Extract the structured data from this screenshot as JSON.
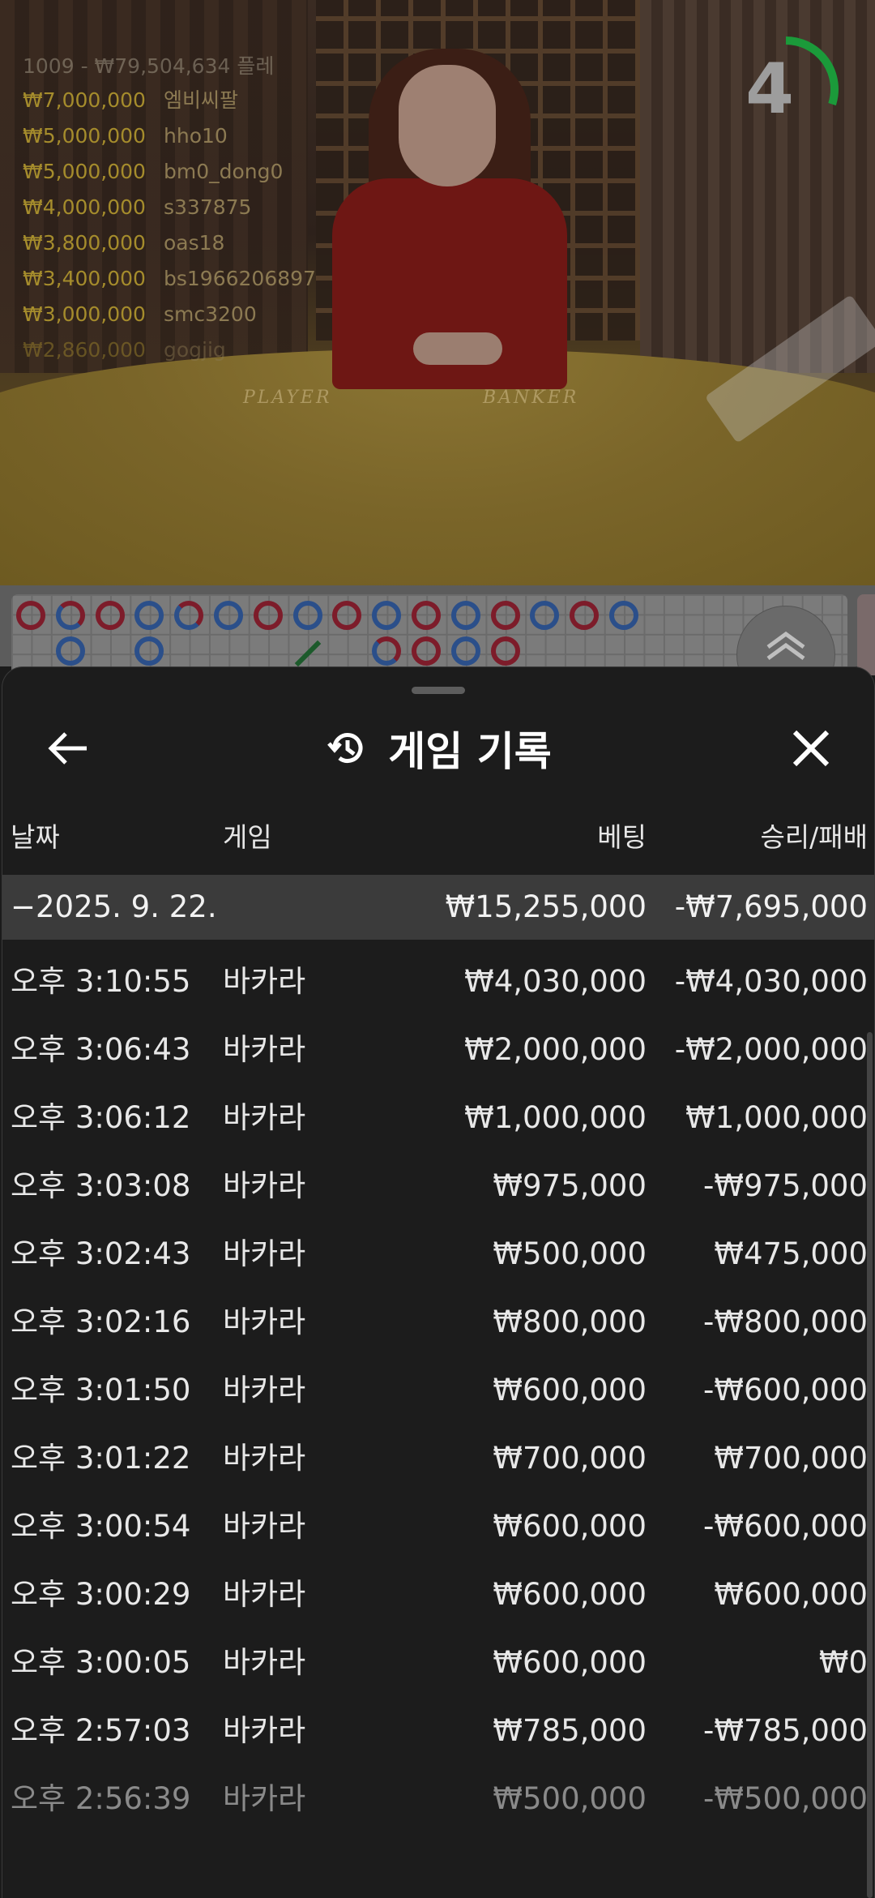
{
  "video": {
    "bet_feed_header": "1009 - ₩79,504,634 플레",
    "bets": [
      {
        "amount": "₩7,000,000",
        "user": "엠비씨팔"
      },
      {
        "amount": "₩5,000,000",
        "user": "hho10"
      },
      {
        "amount": "₩5,000,000",
        "user": "bm0_dong0"
      },
      {
        "amount": "₩4,000,000",
        "user": "s337875"
      },
      {
        "amount": "₩3,800,000",
        "user": "oas18"
      },
      {
        "amount": "₩3,400,000",
        "user": "bs1966206897"
      },
      {
        "amount": "₩3,000,000",
        "user": "smc3200"
      },
      {
        "amount": "₩2,860,000",
        "user": "gogjig"
      }
    ],
    "table_labels": {
      "player": "PLAYER",
      "banker": "BANKER"
    },
    "countdown": "4",
    "countdown_progress": 0.3,
    "accent_green": "#1b9a3a"
  },
  "roadmap": {
    "top_row": [
      "p",
      "split",
      "p",
      "b",
      "split",
      "b",
      "p",
      "b",
      "p",
      "b",
      "p",
      "b",
      "p",
      "b",
      "p",
      "b"
    ],
    "bottom_row": [
      {
        "col": 1,
        "type": "b"
      },
      {
        "col": 3,
        "type": "b"
      },
      {
        "col": 7,
        "type": "tie"
      },
      {
        "col": 9,
        "type": "split"
      },
      {
        "col": 10,
        "type": "p"
      },
      {
        "col": 11,
        "type": "b"
      },
      {
        "col": 12,
        "type": "p"
      }
    ],
    "scroll_icon": "chevron-up-double-icon"
  },
  "sheet": {
    "title": "게임 기록",
    "icons": {
      "back": "arrow-left-icon",
      "history": "history-icon",
      "close": "close-icon"
    },
    "columns": {
      "date": "날짜",
      "game": "게임",
      "bet": "베팅",
      "win_loss": "승리/패배"
    },
    "summary": {
      "date": "−2025. 9. 22.",
      "bet": "₩15,255,000",
      "win_loss": "-₩7,695,000"
    },
    "rows": [
      {
        "time": "오후 3:10:55",
        "game": "바카라",
        "bet": "₩4,030,000",
        "result": "-₩4,030,000"
      },
      {
        "time": "오후 3:06:43",
        "game": "바카라",
        "bet": "₩2,000,000",
        "result": "-₩2,000,000"
      },
      {
        "time": "오후 3:06:12",
        "game": "바카라",
        "bet": "₩1,000,000",
        "result": "₩1,000,000"
      },
      {
        "time": "오후 3:03:08",
        "game": "바카라",
        "bet": "₩975,000",
        "result": "-₩975,000"
      },
      {
        "time": "오후 3:02:43",
        "game": "바카라",
        "bet": "₩500,000",
        "result": "₩475,000"
      },
      {
        "time": "오후 3:02:16",
        "game": "바카라",
        "bet": "₩800,000",
        "result": "-₩800,000"
      },
      {
        "time": "오후 3:01:50",
        "game": "바카라",
        "bet": "₩600,000",
        "result": "-₩600,000"
      },
      {
        "time": "오후 3:01:22",
        "game": "바카라",
        "bet": "₩700,000",
        "result": "₩700,000"
      },
      {
        "time": "오후 3:00:54",
        "game": "바카라",
        "bet": "₩600,000",
        "result": "-₩600,000"
      },
      {
        "time": "오후 3:00:29",
        "game": "바카라",
        "bet": "₩600,000",
        "result": "₩600,000"
      },
      {
        "time": "오후 3:00:05",
        "game": "바카라",
        "bet": "₩600,000",
        "result": "₩0"
      },
      {
        "time": "오후 2:57:03",
        "game": "바카라",
        "bet": "₩785,000",
        "result": "-₩785,000"
      },
      {
        "time": "오후 2:56:39",
        "game": "바카라",
        "bet": "₩500,000",
        "result": "-₩500,000"
      }
    ]
  }
}
